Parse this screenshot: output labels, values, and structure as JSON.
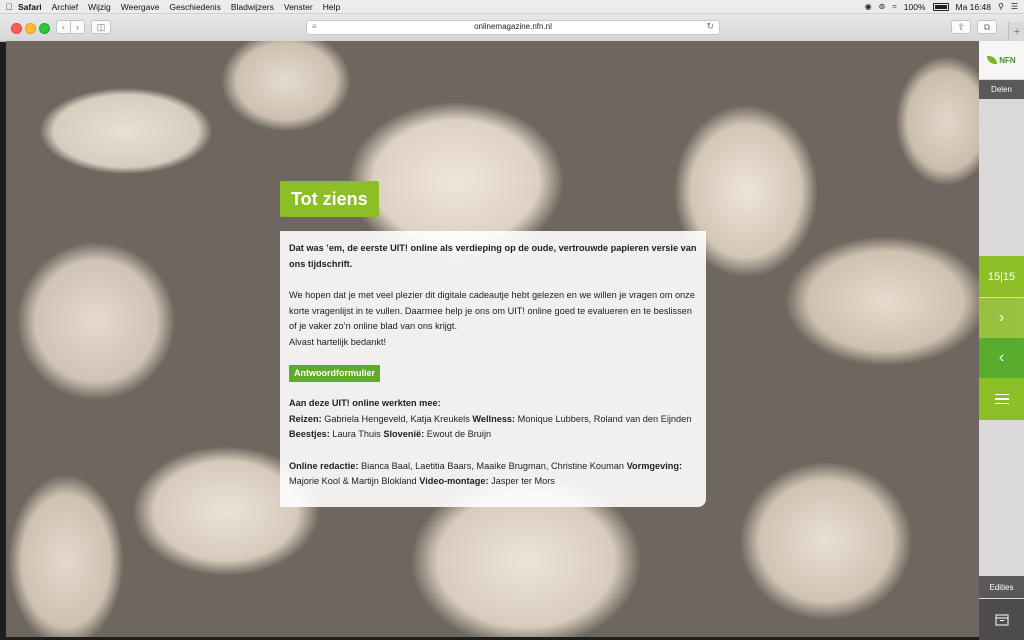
{
  "menubar": {
    "apple": "",
    "items": [
      "Safari",
      "Archief",
      "Wijzig",
      "Weergave",
      "Geschiedenis",
      "Bladwijzers",
      "Venster",
      "Help"
    ],
    "battery": "100%",
    "clock": "Ma 16:48"
  },
  "browser": {
    "url": "onlinemagazine.nfn.nl"
  },
  "page": {
    "title": "Tot ziens",
    "lead": "Dat was ’em, de eerste UIT! online als verdieping op de oude, vertrouwde papieren versie van ons tijdschrift.",
    "body1": "We hopen dat je met veel plezier dit digitale cadeautje hebt gelezen en we willen je vragen om onze korte vragenlijst in te vullen. Daarmee help je ons om UIT! online goed te evalueren en te beslissen of je vaker zo’n online blad van ons krijgt.",
    "body2": "Alvast hartelijk bedankt!",
    "cta": "Antwoordformulier",
    "credits_heading": "Aan deze UIT! online werkten mee:",
    "credits": {
      "reizen_label": "Reizen:",
      "reizen": "Gabriela Hengeveld, Katja Kreukels",
      "wellness_label": "Wellness:",
      "wellness": "Monique Lubbers, Roland van den Eijnden",
      "beestjes_label": "Beestjes:",
      "beestjes": "Laura Thuis",
      "slovenie_label": "Slovenië:",
      "slovenie": "Ewout de Bruijn",
      "redactie_label": "Online redactie:",
      "redactie": "Bianca Baal, Laetitia Baars, Maaike Brugman, Christine Kouman",
      "vormgeving_label": "Vormgeving:",
      "vormgeving": "Majorie Kool & Martijn Blokland",
      "video_label": "Video-montage:",
      "video": "Jasper ter Mors"
    }
  },
  "sidebar": {
    "logo": "NFN",
    "share": "Delen",
    "pager": "15|15",
    "editions": "Edities"
  },
  "colors": {
    "accent": "#8cbf26",
    "accent_dark": "#58ad2e",
    "sidebar_dark": "#595959"
  }
}
